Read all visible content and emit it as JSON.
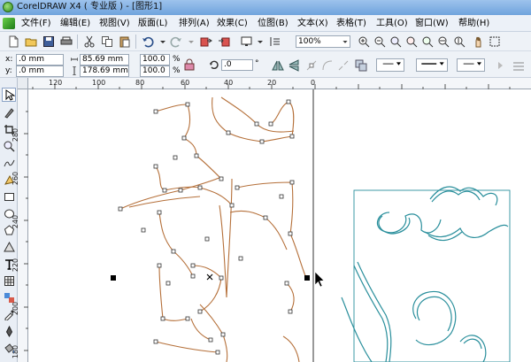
{
  "window": {
    "title": "CorelDRAW X4 ( 专业版 ) - [图形1]"
  },
  "menu": {
    "items": [
      "文件(F)",
      "编辑(E)",
      "视图(V)",
      "版面(L)",
      "排列(A)",
      "效果(C)",
      "位图(B)",
      "文本(X)",
      "表格(T)",
      "工具(O)",
      "窗口(W)",
      "帮助(H)"
    ]
  },
  "toolbar": {
    "zoom_value": "100%"
  },
  "property_bar": {
    "x_label": "x:",
    "x_value": ".0 mm",
    "y_label": "y:",
    "y_value": ".0 mm",
    "width_value": "85.69 mm",
    "height_value": "178.69 mm",
    "scale_w": "100.0",
    "scale_h": "100.0",
    "percent": "%",
    "rotation_value": ".0",
    "degree_symbol": "°"
  },
  "ruler": {
    "top_ticks": [
      "120",
      "100",
      "80",
      "60",
      "40",
      "20",
      "0"
    ],
    "left_ticks": [
      "280",
      "260",
      "240",
      "220",
      "200",
      "180"
    ]
  },
  "colors": {
    "stroke_brown": "#b5703a",
    "stroke_teal": "#2a8f9c",
    "titlebar": "#7fb0e6"
  }
}
